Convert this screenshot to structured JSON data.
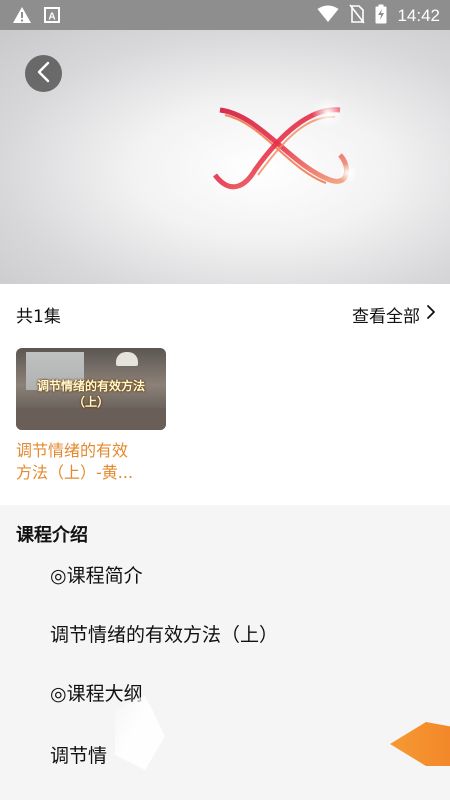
{
  "status_bar": {
    "time": "14:42",
    "icons": [
      "warning-icon",
      "a-box-icon",
      "wifi-icon",
      "no-sim-icon",
      "battery-charging-icon"
    ]
  },
  "video": {
    "back_icon": "chevron-left-icon",
    "logo": "red-orange-infinity-swirl"
  },
  "episodes": {
    "count_label": "共1集",
    "view_all_label": "查看全部",
    "items": [
      {
        "thumbnail_title_line1": "调节情绪的有效方法",
        "thumbnail_title_line2": "（上）",
        "title_line1": "调节情绪的有效",
        "title_line2": "方法（上）-黄..."
      }
    ]
  },
  "intro": {
    "heading": "课程介绍",
    "lines": [
      "◎课程简介",
      "调节情绪的有效方法（上）",
      "◎课程大纲",
      "调节情"
    ]
  },
  "colors": {
    "accent_orange": "#e4892f",
    "status_bar": "#8e8e8e",
    "section_bg": "#f5f5f5"
  }
}
